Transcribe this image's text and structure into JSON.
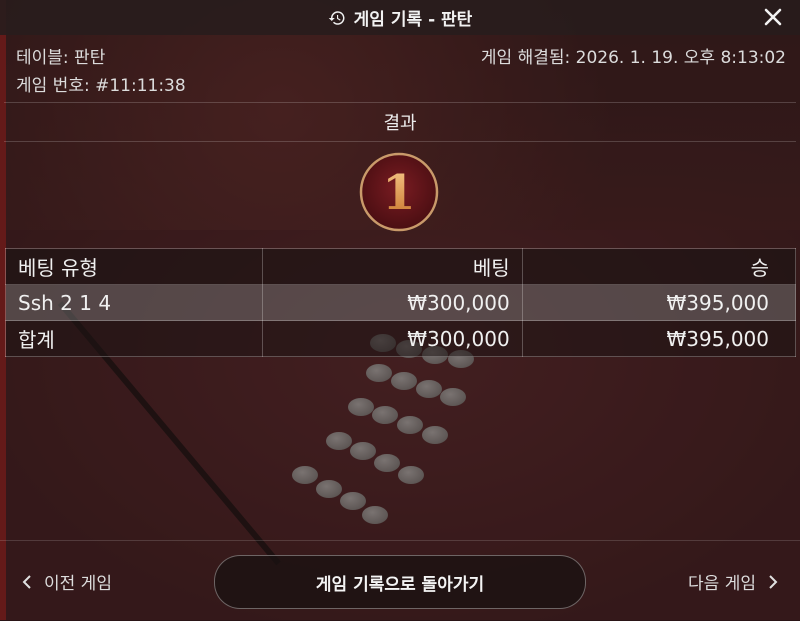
{
  "header": {
    "title": "게임 기록 - 판탄"
  },
  "info": {
    "table": "테이블: 판탄",
    "game_number": "게임 번호: #11:11:38",
    "resolved": "게임 해결됨: 2026. 1. 19. 오후 8:13:02"
  },
  "result": {
    "title": "결과",
    "value": "1"
  },
  "bets": {
    "headers": [
      "베팅 유형",
      "베팅",
      "승"
    ],
    "rows": [
      {
        "type": "Ssh 2 1 4",
        "bet": "₩300,000",
        "win": "₩395,000"
      }
    ],
    "total": {
      "label": "합계",
      "bet": "₩300,000",
      "win": "₩395,000"
    }
  },
  "footer": {
    "prev": "이전 게임",
    "back": "게임 기록으로 돌아가기",
    "next": "다음 게임"
  },
  "colors": {
    "badge_bg": "#5c1418",
    "badge_ring": "#c99a6a",
    "badge_numeral": "#e6a15c"
  },
  "icons": {
    "history": "history-icon",
    "close": "close-icon",
    "prev": "chevron-left-icon",
    "next": "chevron-right-icon"
  }
}
